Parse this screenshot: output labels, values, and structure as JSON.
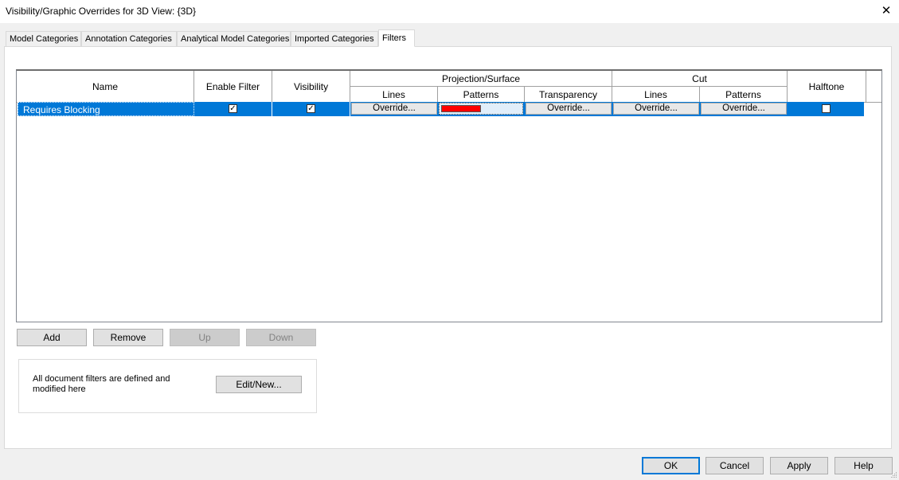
{
  "window": {
    "title": "Visibility/Graphic Overrides for 3D View: {3D}",
    "close_glyph": "✕"
  },
  "tabs": [
    {
      "label": "Model Categories",
      "active": false
    },
    {
      "label": "Annotation Categories",
      "active": false
    },
    {
      "label": "Analytical Model Categories",
      "active": false
    },
    {
      "label": "Imported Categories",
      "active": false
    },
    {
      "label": "Filters",
      "active": true
    }
  ],
  "grid": {
    "headers": {
      "name": "Name",
      "enable_filter": "Enable Filter",
      "visibility": "Visibility",
      "projection_surface": "Projection/Surface",
      "proj_lines": "Lines",
      "proj_patterns": "Patterns",
      "proj_transparency": "Transparency",
      "cut": "Cut",
      "cut_lines": "Lines",
      "cut_patterns": "Patterns",
      "halftone": "Halftone"
    },
    "rows": [
      {
        "name": "Requires Blocking",
        "enable_filter": true,
        "visibility": true,
        "proj_lines": "Override...",
        "proj_patterns_color": "#ff0000",
        "proj_transparency": "Override...",
        "cut_lines": "Override...",
        "cut_patterns": "Override...",
        "halftone": false
      }
    ],
    "selected_row_color": "#0078d7",
    "check_glyph": "✓"
  },
  "row_buttons": {
    "add": "Add",
    "remove": "Remove",
    "up": "Up",
    "down": "Down"
  },
  "filters_group": {
    "description": "All document filters are defined and modified here",
    "edit_new": "Edit/New..."
  },
  "footer": {
    "ok": "OK",
    "cancel": "Cancel",
    "apply": "Apply",
    "help": "Help"
  }
}
